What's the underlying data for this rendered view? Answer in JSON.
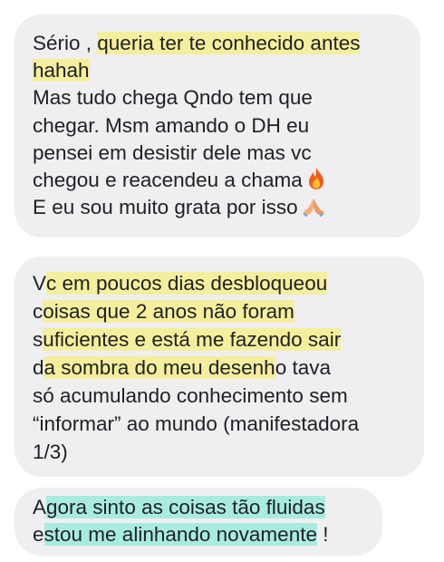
{
  "messages": [
    {
      "lines": [
        {
          "pre": "Sério , ",
          "hl": "queria ter te conhecido antes",
          "post": ""
        },
        {
          "pre": "",
          "hl": "hahah ",
          "post": ""
        },
        {
          "text": "Mas tudo chega Qndo tem que"
        },
        {
          "text": "chegar.  Msm amando o DH eu"
        },
        {
          "text": "pensei em desistir dele mas vc"
        },
        {
          "text": "chegou e reacendeu a chama"
        },
        {
          "text": "E eu sou muito grata por isso"
        }
      ],
      "emojis": [
        "fire-emoji",
        "folded-hands-emoji"
      ]
    },
    {
      "lines": [
        {
          "pre": "V",
          "hl": "c em poucos dias desbloqueou",
          "post": ""
        },
        {
          "pre": "c",
          "hl": "oisas que 2 anos não foram",
          "post": ""
        },
        {
          "pre": "s",
          "hl": "uficientes e está me fazendo sair",
          "post": ""
        },
        {
          "pre": "d",
          "hl": "a sombra do meu desenh",
          "post": "o tava"
        },
        {
          "text": "só acumulando conhecimento sem"
        },
        {
          "text": "“informar” ao mundo (manifestadora"
        },
        {
          "text": "1/3)"
        }
      ]
    },
    {
      "lines": [
        {
          "pre": "A",
          "hl": "gora sinto as coisas tão fluidas",
          "post": ""
        },
        {
          "pre": "e",
          "hl": "stou me alinhando novamente",
          "post": " !"
        }
      ]
    }
  ]
}
